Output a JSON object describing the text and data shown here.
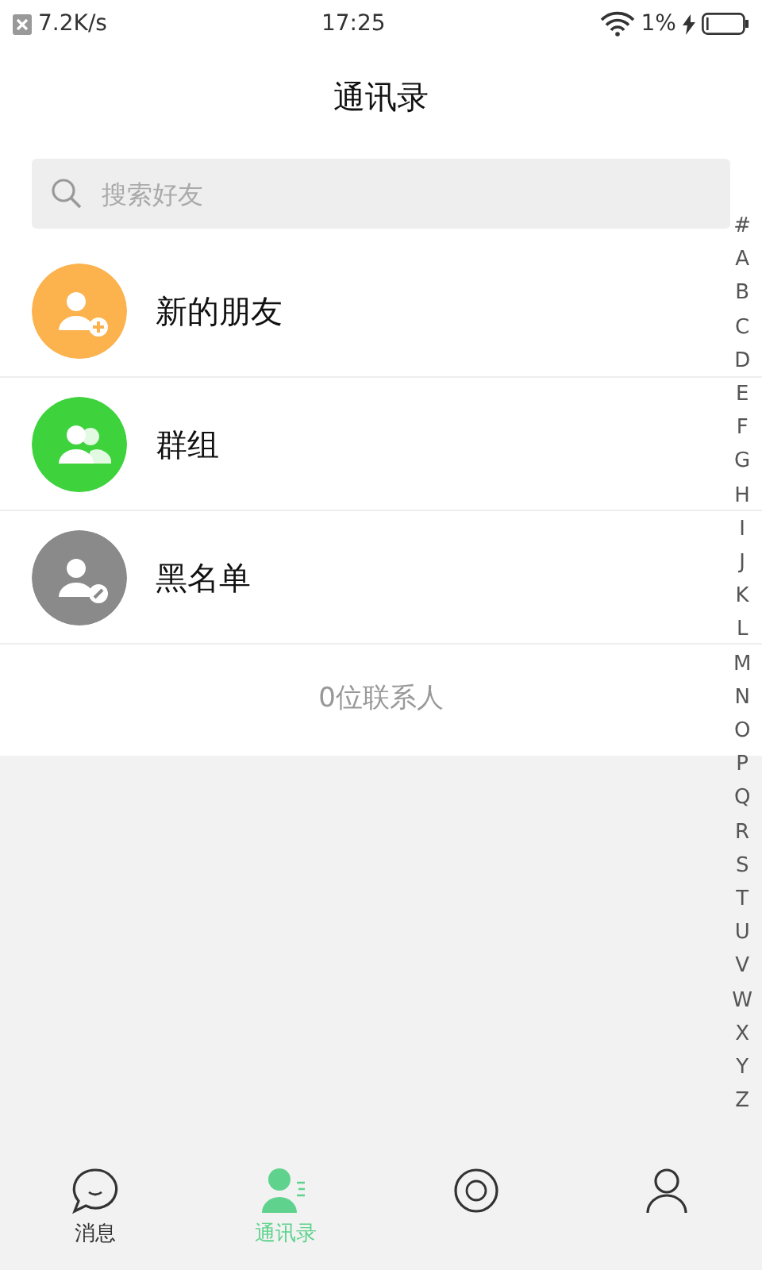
{
  "status_bar": {
    "speed": "7.2K/s",
    "time": "17:25",
    "battery": "1%"
  },
  "title": "通讯录",
  "search": {
    "placeholder": "搜索好友"
  },
  "entries": [
    {
      "kind": "add",
      "label": "新的朋友",
      "color": "#fcb24d"
    },
    {
      "kind": "group",
      "label": "群组",
      "color": "#3ed33d"
    },
    {
      "kind": "block",
      "label": "黑名单",
      "color": "#8a8a8a"
    }
  ],
  "contact_count": "0位联系人",
  "index": [
    "#",
    "A",
    "B",
    "C",
    "D",
    "E",
    "F",
    "G",
    "H",
    "I",
    "J",
    "K",
    "L",
    "M",
    "N",
    "O",
    "P",
    "Q",
    "R",
    "S",
    "T",
    "U",
    "V",
    "W",
    "X",
    "Y",
    "Z"
  ],
  "tabs": [
    {
      "kind": "chat",
      "label": "消息",
      "selected": false
    },
    {
      "kind": "contacts",
      "label": "通讯录",
      "selected": true
    },
    {
      "kind": "discover",
      "selected": false
    },
    {
      "kind": "me",
      "selected": false
    }
  ]
}
